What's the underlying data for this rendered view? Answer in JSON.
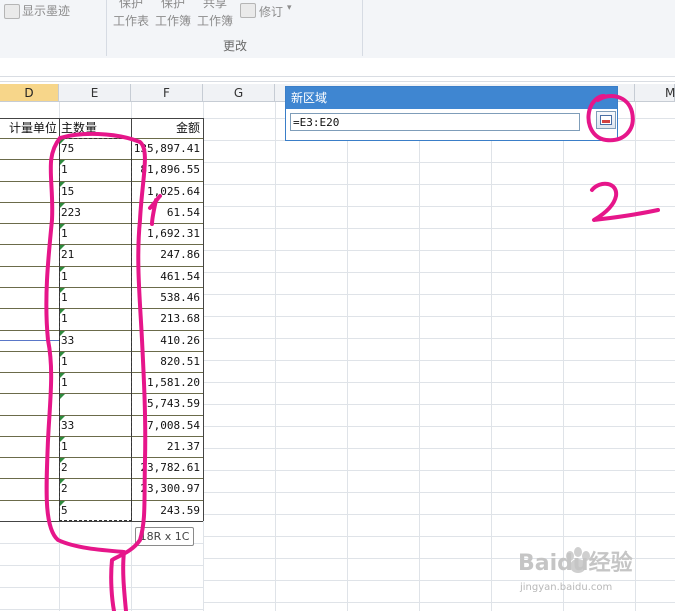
{
  "ribbon": {
    "show_ink_label": "显示墨迹",
    "protect_sheet_top": "保护",
    "protect_sheet_bottom": "工作表",
    "protect_book_top": "保护",
    "protect_book_bottom": "工作簿",
    "share_book_top": "共享",
    "share_book_bottom": "工作簿",
    "track_changes_label": "修订",
    "group_changes_label": "更改"
  },
  "columns": [
    "D",
    "E",
    "F",
    "G",
    "M"
  ],
  "headers": {
    "unit": "计量单位",
    "qty": "主数量",
    "amount": "金额"
  },
  "rows": [
    {
      "qty": "75",
      "amount": "135,897.41"
    },
    {
      "qty": "1",
      "amount": "81,896.55"
    },
    {
      "qty": "15",
      "amount": "1,025.64"
    },
    {
      "qty": "223",
      "amount": "61.54"
    },
    {
      "qty": "1",
      "amount": "1,692.31"
    },
    {
      "qty": "21",
      "amount": "247.86"
    },
    {
      "qty": "1",
      "amount": "461.54"
    },
    {
      "qty": "1",
      "amount": "538.46"
    },
    {
      "qty": "1",
      "amount": "213.68"
    },
    {
      "qty": "33",
      "amount": "410.26"
    },
    {
      "qty": "1",
      "amount": "820.51"
    },
    {
      "qty": "1",
      "amount": "1,581.20"
    },
    {
      "qty": "",
      "amount": "5,743.59"
    },
    {
      "qty": "33",
      "amount": "7,008.54"
    },
    {
      "qty": "1",
      "amount": "21.37"
    },
    {
      "qty": "2",
      "amount": "23,782.61"
    },
    {
      "qty": "2",
      "amount": "23,300.97"
    },
    {
      "qty": "5",
      "amount": "243.59"
    }
  ],
  "dialog": {
    "title": "新区域",
    "value": "=E3:E20"
  },
  "tooltip": "18R x 1C",
  "watermark": {
    "brand": "Baidu经验",
    "url": "jingyan.baidu.com"
  },
  "annotations": {
    "mark_one": "1",
    "mark_two": "2"
  },
  "colors": {
    "dialog_title_bg": "#3f86d1",
    "selected_col_header": "#f7d68a",
    "annotation_ink": "#e6168a"
  }
}
